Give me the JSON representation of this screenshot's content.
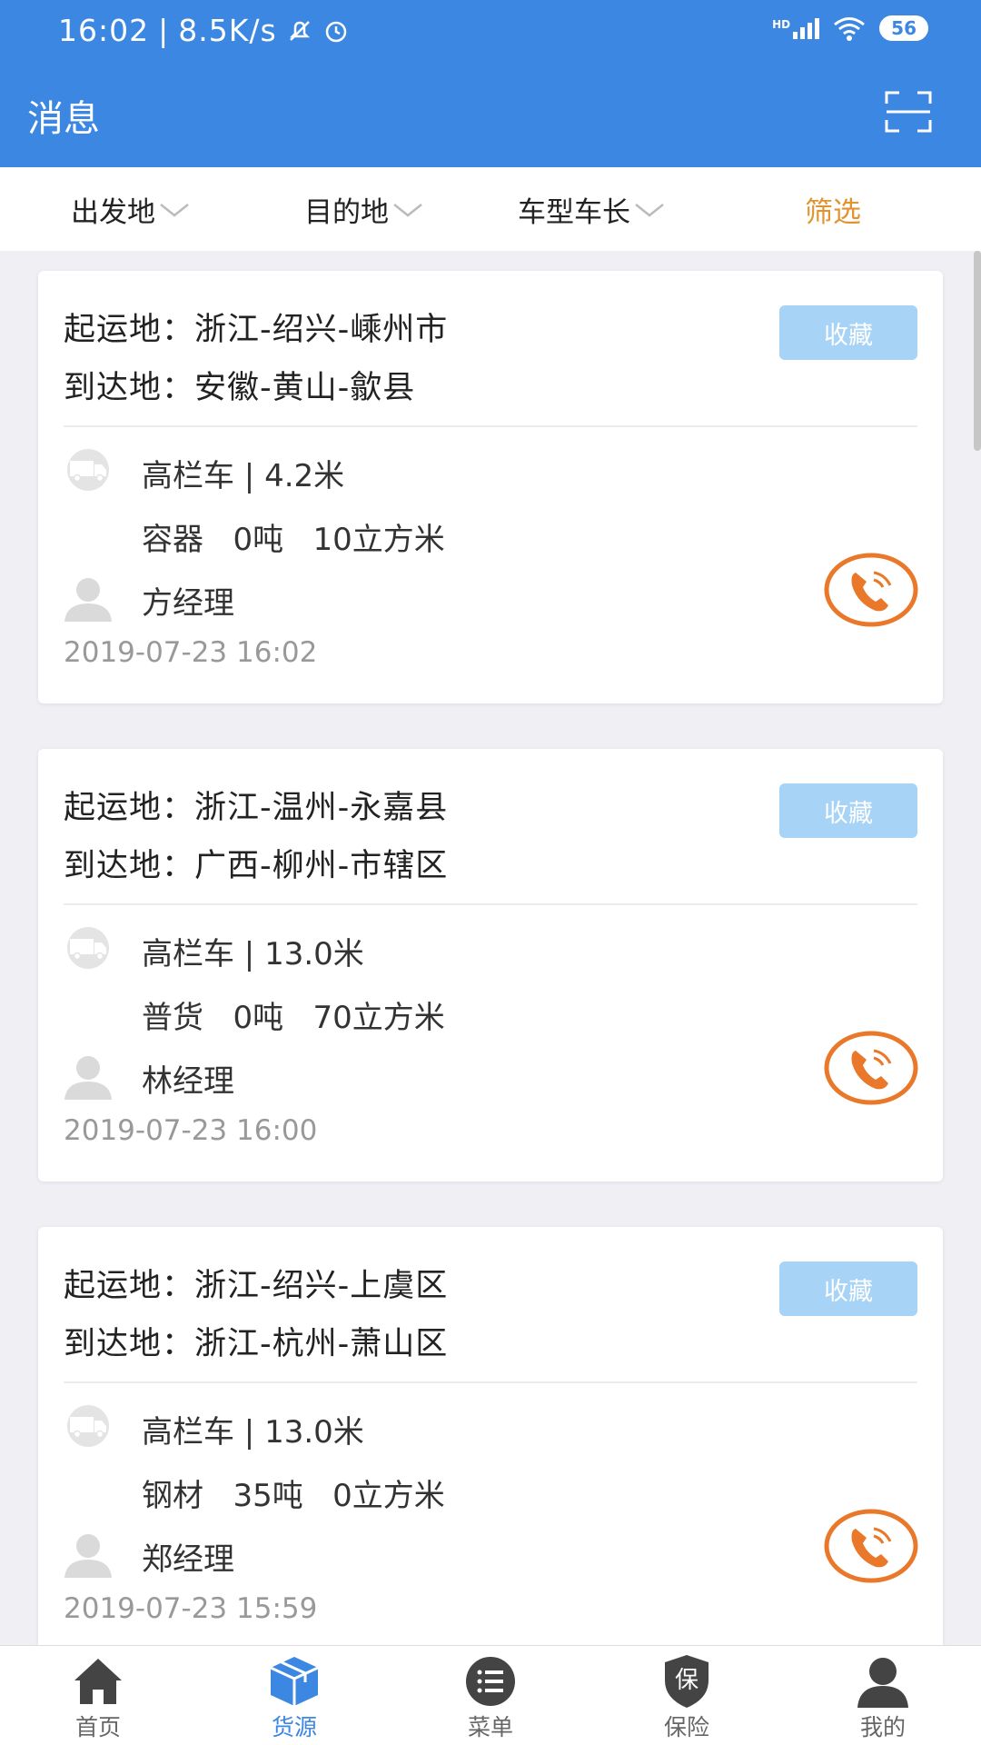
{
  "status_bar": {
    "time": "16:02",
    "speed": "8.5K/s",
    "network": "HD",
    "battery": "56"
  },
  "header": {
    "title": "消息"
  },
  "filters": {
    "origin": "出发地",
    "destination": "目的地",
    "vehicle": "车型车长",
    "filter": "筛选"
  },
  "cards": [
    {
      "from_label": "起运地：",
      "from": "浙江-绍兴-嵊州市",
      "to_label": "到达地：",
      "to": "安徽-黄山-歙县",
      "favorite": "收藏",
      "vehicle": "高栏车 | 4.2米",
      "goods": "容器",
      "weight": "0吨",
      "volume": "10立方米",
      "contact": "方经理",
      "time": "2019-07-23 16:02"
    },
    {
      "from_label": "起运地：",
      "from": "浙江-温州-永嘉县",
      "to_label": "到达地：",
      "to": "广西-柳州-市辖区",
      "favorite": "收藏",
      "vehicle": "高栏车 | 13.0米",
      "goods": "普货",
      "weight": "0吨",
      "volume": "70立方米",
      "contact": "林经理",
      "time": "2019-07-23 16:00"
    },
    {
      "from_label": "起运地：",
      "from": "浙江-绍兴-上虞区",
      "to_label": "到达地：",
      "to": "浙江-杭州-萧山区",
      "favorite": "收藏",
      "vehicle": "高栏车 | 13.0米",
      "goods": "钢材",
      "weight": "35吨",
      "volume": "0立方米",
      "contact": "郑经理",
      "time": "2019-07-23 15:59"
    }
  ],
  "tabs": [
    {
      "label": "首页",
      "icon": "home-icon"
    },
    {
      "label": "货源",
      "icon": "box-icon"
    },
    {
      "label": "菜单",
      "icon": "menu-icon"
    },
    {
      "label": "保险",
      "icon": "shield-icon",
      "glyph": "保"
    },
    {
      "label": "我的",
      "icon": "user-icon"
    }
  ],
  "colors": {
    "primary": "#3c87e2",
    "accent": "#e3932e",
    "phone": "#e9782b",
    "favorite_bg": "#a6d3f6"
  }
}
